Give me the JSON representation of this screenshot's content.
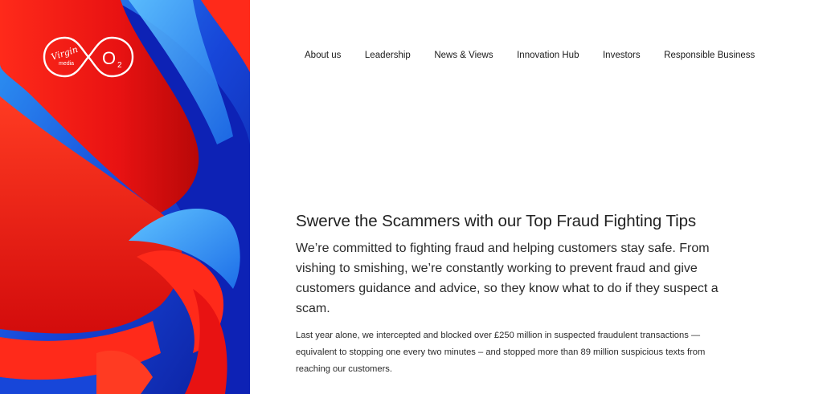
{
  "brand": {
    "logo_text_1": "Virgin",
    "logo_text_2": "media",
    "logo_text_3": "O",
    "logo_text_4": "2",
    "colors": {
      "red": "#e81e1e",
      "blue": "#1a3fd6",
      "light_blue": "#2a8ef0",
      "navy": "#0a1a8c"
    }
  },
  "nav": {
    "items": [
      {
        "label": "About us"
      },
      {
        "label": "Leadership"
      },
      {
        "label": "News & Views"
      },
      {
        "label": "Innovation Hub"
      },
      {
        "label": "Investors"
      },
      {
        "label": "Responsible Business"
      }
    ]
  },
  "article": {
    "title": "Swerve the Scammers with our Top Fraud Fighting Tips",
    "lead": "We’re committed to fighting fraud and helping customers stay safe. From vishing to smishing, we’re constantly working to prevent fraud and give customers guidance and advice, so they know what to do if they suspect a scam.",
    "body": "Last year alone, we intercepted and blocked over £250 million in suspected fraudulent transactions — equivalent to stopping one every two minutes – and stopped more than 89 million suspicious texts from reaching our customers."
  }
}
